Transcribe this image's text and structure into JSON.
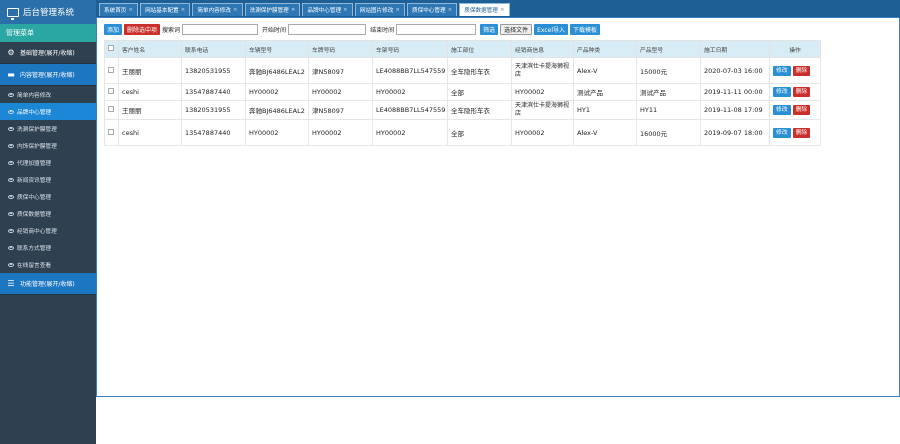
{
  "sidebar": {
    "app_title": "后台管理系统",
    "menu_title": "管理菜单",
    "groups": [
      {
        "label": "基础管理(展开/收缩)"
      },
      {
        "label": "内容管理(展开/收缩)"
      },
      {
        "label": "功能管理(展开/收缩)"
      }
    ],
    "items": [
      {
        "label": "简单内容修改"
      },
      {
        "label": "品牌中心管理"
      },
      {
        "label": "洗涮保护膜管理"
      },
      {
        "label": "内饰保护膜管理"
      },
      {
        "label": "代理加盟管理"
      },
      {
        "label": "新闻资讯管理"
      },
      {
        "label": "质保中心管理"
      },
      {
        "label": "质保数据管理"
      },
      {
        "label": "经销商中心管理"
      },
      {
        "label": "联系方式管理"
      },
      {
        "label": "在线留言查看"
      }
    ]
  },
  "tabs": [
    {
      "label": "系统首页"
    },
    {
      "label": "网站基本配置"
    },
    {
      "label": "简单内容修改"
    },
    {
      "label": "洗涮保护膜管理"
    },
    {
      "label": "品牌中心管理"
    },
    {
      "label": "网站图片修改"
    },
    {
      "label": "质保中心管理"
    },
    {
      "label": "质保数据管理"
    }
  ],
  "tab_close": "×",
  "toolbar": {
    "add": "添加",
    "delete_selected": "删除选中项",
    "search_label": "搜索词",
    "start_label": "开始时间",
    "end_label": "结束时间",
    "filter": "筛选",
    "choose_file": "选择文件",
    "excel_import": "Excel导入",
    "download_template": "下载模板"
  },
  "table": {
    "headers": [
      "客户姓名",
      "联系电话",
      "车辆型号",
      "车牌号码",
      "车架号码",
      "施工部位",
      "经销商信息",
      "产品种类",
      "产品型号",
      "施工日期",
      "操作"
    ],
    "rows": [
      [
        "王丽丽",
        "13820531955",
        "奔驰BJ6486LEAL2",
        "津N58097",
        "LE4088BB7LL547559",
        "全车隐形车衣",
        "天津滨仕卡提海狮视店",
        "Alex-V",
        "15000元",
        "2020-07-03 16:00"
      ],
      [
        "ceshi",
        "13547887440",
        "HY00002",
        "HY00002",
        "HY00002",
        "全部",
        "HY00002",
        "测试产品",
        "测试产品",
        "2019-11-11 00:00"
      ],
      [
        "王丽丽",
        "13820531955",
        "奔驰BJ6486LEAL2",
        "津N58097",
        "LE4088BB7LL547559",
        "全车隐形车衣",
        "天津滨仕卡提海狮视店",
        "HY1",
        "HY11",
        "2019-11-08 17:09"
      ],
      [
        "ceshi",
        "13547887440",
        "HY00002",
        "HY00002",
        "HY00002",
        "全部",
        "HY00002",
        "Alex-V",
        "16000元",
        "2019-09-07 18:00"
      ]
    ],
    "edit": "修改",
    "delete": "删除"
  },
  "colors": {
    "sidebar": "#2f4050",
    "accent": "#2a8fd4",
    "danger": "#c9302c",
    "header_bg": "#d7ecf4"
  }
}
